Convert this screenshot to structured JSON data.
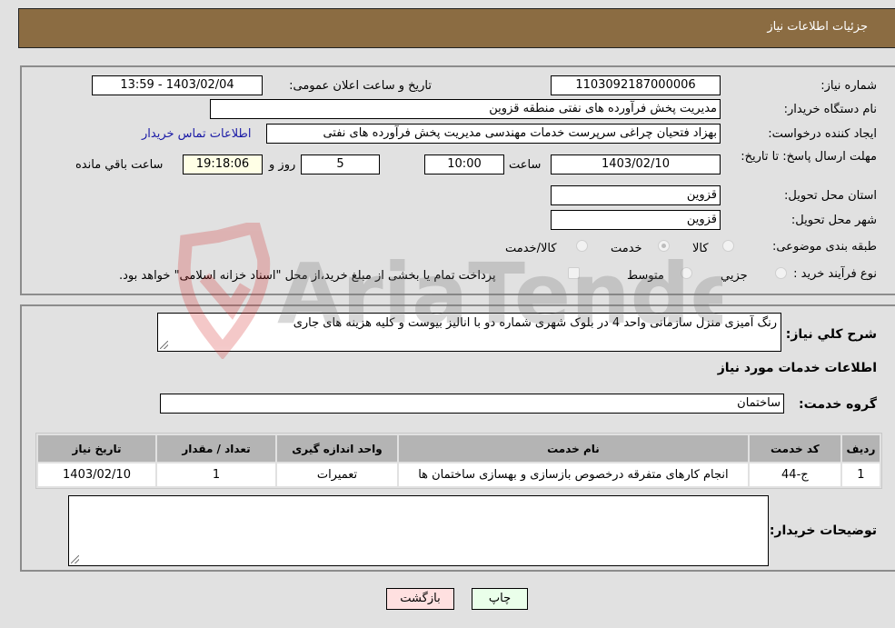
{
  "header": {
    "title": "جزئیات اطلاعات نیاز"
  },
  "form": {
    "need_number": {
      "label": "شماره نیاز:",
      "value": "1103092187000006"
    },
    "announce_datetime": {
      "label": "تاریخ و ساعت اعلان عمومی:",
      "value": "1403/02/04 - 13:59"
    },
    "buyer_org": {
      "label": "نام دستگاه خریدار:",
      "value": "مدیریت پخش فرآورده های نفتی منطقه قزوین"
    },
    "requester": {
      "label": "ایجاد کننده درخواست:",
      "value": "بهزاد فتحیان چراغی سرپرست خدمات مهندسی مدیریت پخش فرآورده های نفتی",
      "contact_link": "اطلاعات تماس خریدار"
    },
    "deadline": {
      "label": "مهلت ارسال پاسخ: تا تاریخ:",
      "date": "1403/02/10",
      "time_label": "ساعت",
      "time": "10:00",
      "days": "5",
      "days_label": "روز و",
      "remaining": "19:18:06",
      "remaining_label": "ساعت باقي مانده"
    },
    "province": {
      "label": "استان محل تحویل:",
      "value": "قزوین"
    },
    "city": {
      "label": "شهر محل تحویل:",
      "value": "قزوین"
    },
    "category": {
      "label": "طبقه بندی موضوعی:",
      "options": [
        "کالا",
        "خدمت",
        "کالا/خدمت"
      ],
      "selected": "خدمت"
    },
    "purchase_type": {
      "label": "نوع فرآیند خرید :",
      "options": [
        "جزيي",
        "متوسط"
      ],
      "selected": "",
      "treasury_note": "پرداخت تمام یا بخشی از مبلغ خرید،از محل \"اسناد خزانه اسلامی\" خواهد بود."
    }
  },
  "details": {
    "description_label": "شرح کلي نياز:",
    "description": "رنگ آمیزی منزل سازمانی واحد 4 در بلوک شهری شماره دو با انالیز بیوست و کلیه هزینه های جاری",
    "services_heading": "اطلاعات خدمات مورد نیاز",
    "service_group_label": "گروه خدمت:",
    "service_group": "ساختمان",
    "table": {
      "headers": [
        "ردیف",
        "کد خدمت",
        "نام خدمت",
        "واحد اندازه گیری",
        "تعداد / مقدار",
        "تاریخ نیاز"
      ],
      "rows": [
        [
          "1",
          "ج-44",
          "انجام کارهای متفرقه درخصوص بازسازی و بهسازی ساختمان ها",
          "تعمیرات",
          "1",
          "1403/02/10"
        ]
      ]
    },
    "buyer_notes_label": "توضیحات خریدار:",
    "buyer_notes": ""
  },
  "buttons": {
    "print": "چاپ",
    "back": "بازگشت"
  },
  "watermark": {
    "text": "AriaTender.neT"
  }
}
